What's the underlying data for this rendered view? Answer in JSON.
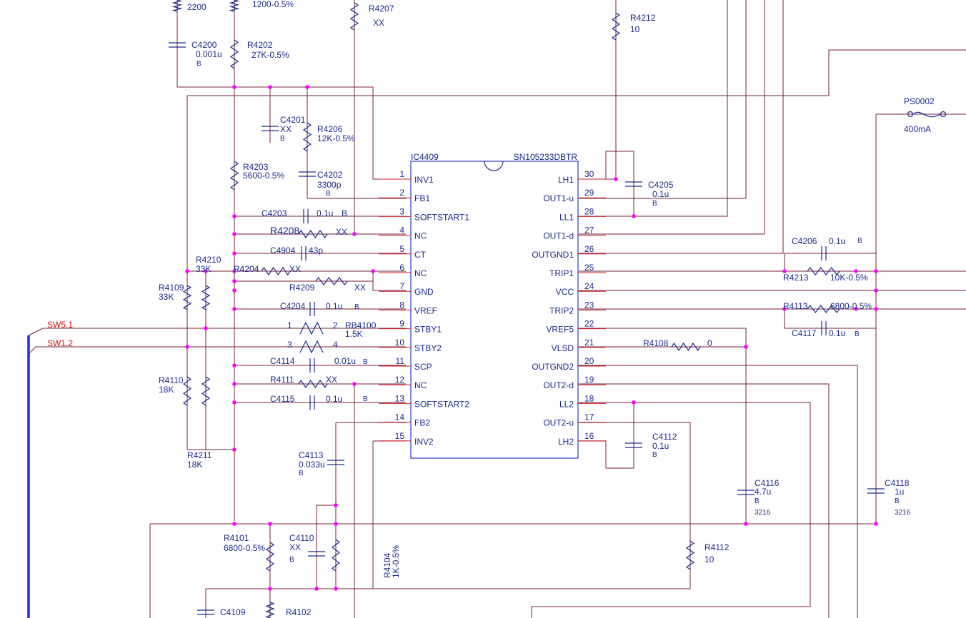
{
  "ic": {
    "ref": "IC4409",
    "part": "SN105233DBTR",
    "left_pins": [
      {
        "num": "1",
        "name": "INV1"
      },
      {
        "num": "2",
        "name": "FB1"
      },
      {
        "num": "3",
        "name": "SOFTSTART1"
      },
      {
        "num": "4",
        "name": "NC"
      },
      {
        "num": "5",
        "name": "CT"
      },
      {
        "num": "6",
        "name": "NC"
      },
      {
        "num": "7",
        "name": "GND"
      },
      {
        "num": "8",
        "name": "VREF"
      },
      {
        "num": "9",
        "name": "STBY1"
      },
      {
        "num": "10",
        "name": "STBY2"
      },
      {
        "num": "11",
        "name": "SCP"
      },
      {
        "num": "12",
        "name": "NC"
      },
      {
        "num": "13",
        "name": "SOFTSTART2"
      },
      {
        "num": "14",
        "name": "FB2"
      },
      {
        "num": "15",
        "name": "INV2"
      }
    ],
    "right_pins": [
      {
        "num": "30",
        "name": "LH1"
      },
      {
        "num": "29",
        "name": "OUT1-u"
      },
      {
        "num": "28",
        "name": "LL1"
      },
      {
        "num": "27",
        "name": "OUT1-d"
      },
      {
        "num": "26",
        "name": "OUTGND1"
      },
      {
        "num": "25",
        "name": "TRIP1"
      },
      {
        "num": "24",
        "name": "VCC"
      },
      {
        "num": "23",
        "name": "TRIP2"
      },
      {
        "num": "22",
        "name": "VREF5"
      },
      {
        "num": "21",
        "name": "VLSD"
      },
      {
        "num": "20",
        "name": "OUTGND2"
      },
      {
        "num": "19",
        "name": "OUT2-d"
      },
      {
        "num": "18",
        "name": "LL2"
      },
      {
        "num": "17",
        "name": "OUT2-u"
      },
      {
        "num": "16",
        "name": "LH2"
      }
    ]
  },
  "nets": {
    "sw51": "SW5.1",
    "sw12": "SW1.2"
  },
  "labels": [
    {
      "t": "2200"
    },
    {
      "t": "1200-0.5%"
    },
    {
      "t": "R4207"
    },
    {
      "t": "XX"
    },
    {
      "t": "R4212"
    },
    {
      "t": "10"
    },
    {
      "t": "C4200"
    },
    {
      "t": "0.001u"
    },
    {
      "t": "B"
    },
    {
      "t": "R4202"
    },
    {
      "t": "27K-0.5%"
    },
    {
      "t": "C4201"
    },
    {
      "t": "XX"
    },
    {
      "t": "B"
    },
    {
      "t": "R4206"
    },
    {
      "t": "12K-0.5%"
    },
    {
      "t": "R4203"
    },
    {
      "t": "5600-0.5%"
    },
    {
      "t": "C4202"
    },
    {
      "t": "3300p"
    },
    {
      "t": "B"
    },
    {
      "t": "C4205"
    },
    {
      "t": "0.1u"
    },
    {
      "t": "B"
    },
    {
      "t": "PS0002"
    },
    {
      "t": "400mA"
    },
    {
      "t": "C4203"
    },
    {
      "t": "0.1u"
    },
    {
      "t": "B"
    },
    {
      "t": "R4208"
    },
    {
      "t": "XX"
    },
    {
      "t": "C4904"
    },
    {
      "t": "43p"
    },
    {
      "t": "R4210"
    },
    {
      "t": "33K"
    },
    {
      "t": "R4204"
    },
    {
      "t": "XX"
    },
    {
      "t": "R4109"
    },
    {
      "t": "33K"
    },
    {
      "t": "R4209"
    },
    {
      "t": "XX"
    },
    {
      "t": "C4204"
    },
    {
      "t": "0.1u"
    },
    {
      "t": "B"
    },
    {
      "t": "1"
    },
    {
      "t": "2"
    },
    {
      "t": "RB4100"
    },
    {
      "t": "1.5K"
    },
    {
      "t": "3"
    },
    {
      "t": "4"
    },
    {
      "t": "C4114"
    },
    {
      "t": "0.01u"
    },
    {
      "t": "B"
    },
    {
      "t": "R4111"
    },
    {
      "t": "XX"
    },
    {
      "t": "R4110"
    },
    {
      "t": "18K"
    },
    {
      "t": "C4115"
    },
    {
      "t": "0.1u"
    },
    {
      "t": "B"
    },
    {
      "t": "C4113"
    },
    {
      "t": "0.033u"
    },
    {
      "t": "B"
    },
    {
      "t": "R4211"
    },
    {
      "t": "18K"
    },
    {
      "t": "C4206"
    },
    {
      "t": "0.1u"
    },
    {
      "t": "B"
    },
    {
      "t": "R4213"
    },
    {
      "t": "10K-0.5%"
    },
    {
      "t": "R4113"
    },
    {
      "t": "6800-0.5%"
    },
    {
      "t": "C4117"
    },
    {
      "t": "0.1u"
    },
    {
      "t": "B"
    },
    {
      "t": "R4108"
    },
    {
      "t": "0"
    },
    {
      "t": "C4112"
    },
    {
      "t": "0.1u"
    },
    {
      "t": "B"
    },
    {
      "t": "C4116"
    },
    {
      "t": "4.7u"
    },
    {
      "t": "B"
    },
    {
      "t": "3216"
    },
    {
      "t": "C4118"
    },
    {
      "t": "1u"
    },
    {
      "t": "B"
    },
    {
      "t": "3216"
    },
    {
      "t": "R4101"
    },
    {
      "t": "6800-0.5%"
    },
    {
      "t": "C4110"
    },
    {
      "t": "XX"
    },
    {
      "t": "B"
    },
    {
      "t": "R4104"
    },
    {
      "t": "1K-0.5%"
    },
    {
      "t": "R4112"
    },
    {
      "t": "10"
    },
    {
      "t": "C4109"
    },
    {
      "t": "R4102"
    }
  ]
}
